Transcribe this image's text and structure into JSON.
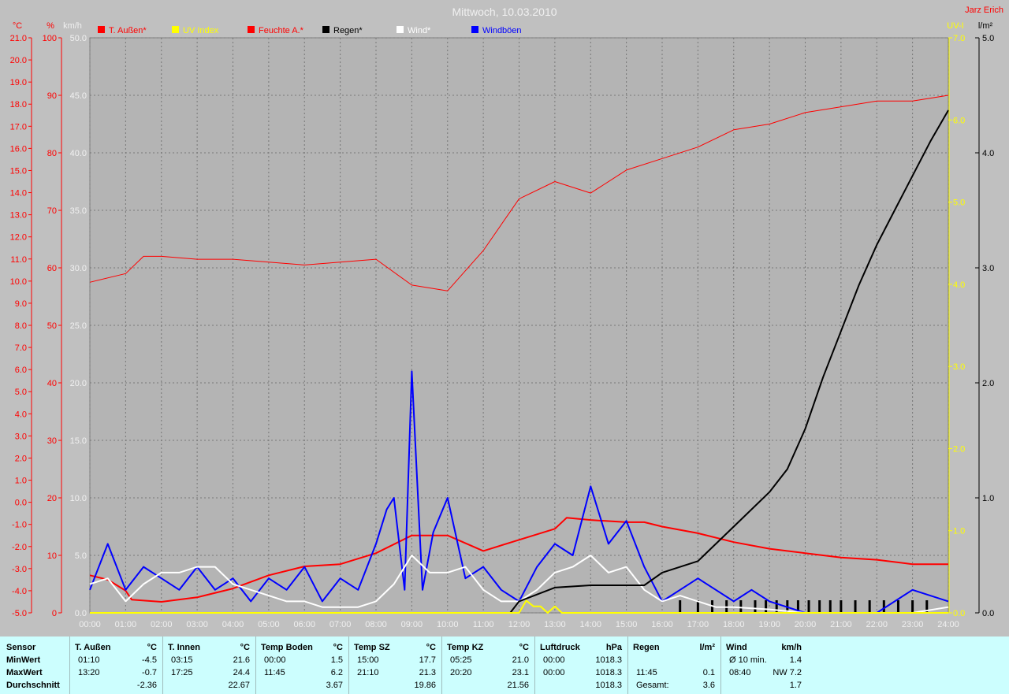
{
  "title": "Mittwoch, 10.03.2010",
  "author": "Jarz Erich",
  "axes": {
    "temp_unit": "°C",
    "temp_ticks": [
      "21.0",
      "20.0",
      "19.0",
      "18.0",
      "17.0",
      "16.0",
      "15.0",
      "14.0",
      "13.0",
      "12.0",
      "11.0",
      "10.0",
      "9.0",
      "8.0",
      "7.0",
      "6.0",
      "5.0",
      "4.0",
      "3.0",
      "2.0",
      "1.0",
      "0.0",
      "-1.0",
      "-2.0",
      "-3.0",
      "-4.0",
      "-5.0"
    ],
    "hum_unit": "%",
    "hum_ticks": [
      "100",
      "90",
      "80",
      "70",
      "60",
      "50",
      "40",
      "30",
      "20",
      "10",
      "0"
    ],
    "wind_unit": "km/h",
    "wind_ticks": [
      "50.0",
      "45.0",
      "40.0",
      "35.0",
      "30.0",
      "25.0",
      "20.0",
      "15.0",
      "10.0",
      "5.0",
      "0.0"
    ],
    "uv_unit": "UV-I",
    "uv_ticks": [
      "7.0",
      "6.0",
      "5.0",
      "4.0",
      "3.0",
      "2.0",
      "1.0",
      "0.0"
    ],
    "rain_unit": "l/m²",
    "rain_ticks": [
      "5.0",
      "4.0",
      "3.0",
      "2.0",
      "1.0",
      "0.0"
    ],
    "x_ticks": [
      "00:00",
      "01:00",
      "02:00",
      "03:00",
      "04:00",
      "05:00",
      "06:00",
      "07:00",
      "08:00",
      "09:00",
      "10:00",
      "11:00",
      "12:00",
      "13:00",
      "14:00",
      "15:00",
      "16:00",
      "17:00",
      "18:00",
      "19:00",
      "20:00",
      "21:00",
      "22:00",
      "23:00",
      "24:00"
    ]
  },
  "legend": [
    {
      "label": "T. Außen*",
      "color": "#ff0000"
    },
    {
      "label": "UV Index",
      "color": "#ffff00"
    },
    {
      "label": "Feuchte A.*",
      "color": "#ff0000"
    },
    {
      "label": "Regen*",
      "color": "#000000"
    },
    {
      "label": "Wind*",
      "color": "#ffffff"
    },
    {
      "label": "Windböen",
      "color": "#0000ff"
    }
  ],
  "chart_data": {
    "type": "line",
    "title": "Mittwoch, 10.03.2010",
    "x_unit": "hour",
    "series": [
      {
        "name": "T. Außen*",
        "axis": "temp",
        "color": "#ff0000",
        "points": [
          [
            0,
            -3.3
          ],
          [
            0.5,
            -3.5
          ],
          [
            1,
            -4.0
          ],
          [
            1.17,
            -4.4
          ],
          [
            2,
            -4.5
          ],
          [
            3,
            -4.3
          ],
          [
            4,
            -3.9
          ],
          [
            5,
            -3.3
          ],
          [
            6,
            -2.9
          ],
          [
            7,
            -2.8
          ],
          [
            8,
            -2.3
          ],
          [
            9,
            -1.5
          ],
          [
            10,
            -1.5
          ],
          [
            11,
            -2.2
          ],
          [
            12,
            -1.7
          ],
          [
            13,
            -1.2
          ],
          [
            13.33,
            -0.7
          ],
          [
            14,
            -0.8
          ],
          [
            15,
            -0.9
          ],
          [
            15.5,
            -0.9
          ],
          [
            16,
            -1.1
          ],
          [
            17,
            -1.4
          ],
          [
            18,
            -1.8
          ],
          [
            19,
            -2.1
          ],
          [
            20,
            -2.3
          ],
          [
            21,
            -2.5
          ],
          [
            22,
            -2.6
          ],
          [
            23,
            -2.8
          ],
          [
            24,
            -2.8
          ]
        ]
      },
      {
        "name": "Feuchte A.*",
        "axis": "hum",
        "color": "#ff0000",
        "points": [
          [
            0,
            57.5
          ],
          [
            1,
            59
          ],
          [
            1.5,
            62
          ],
          [
            2,
            62
          ],
          [
            3,
            61.5
          ],
          [
            4,
            61.5
          ],
          [
            5,
            61
          ],
          [
            6,
            60.5
          ],
          [
            7,
            61
          ],
          [
            8,
            61.5
          ],
          [
            9,
            57
          ],
          [
            10,
            56
          ],
          [
            11,
            63
          ],
          [
            12,
            72
          ],
          [
            13,
            75
          ],
          [
            14,
            73
          ],
          [
            15,
            77
          ],
          [
            16,
            79
          ],
          [
            17,
            81
          ],
          [
            18,
            84
          ],
          [
            19,
            85
          ],
          [
            20,
            87
          ],
          [
            21,
            88
          ],
          [
            22,
            89
          ],
          [
            23,
            89
          ],
          [
            24,
            90
          ]
        ]
      },
      {
        "name": "Windböen",
        "axis": "wind",
        "color": "#0000ff",
        "points": [
          [
            0,
            2
          ],
          [
            0.5,
            6
          ],
          [
            1,
            2
          ],
          [
            1.5,
            4
          ],
          [
            2,
            3
          ],
          [
            2.5,
            2
          ],
          [
            3,
            4
          ],
          [
            3.5,
            2
          ],
          [
            4,
            3
          ],
          [
            4.5,
            1
          ],
          [
            5,
            3
          ],
          [
            5.5,
            2
          ],
          [
            6,
            4
          ],
          [
            6.5,
            1
          ],
          [
            7,
            3
          ],
          [
            7.5,
            2
          ],
          [
            8,
            6
          ],
          [
            8.3,
            9
          ],
          [
            8.5,
            10
          ],
          [
            8.8,
            2
          ],
          [
            9,
            21
          ],
          [
            9.3,
            2
          ],
          [
            9.6,
            7
          ],
          [
            10,
            10
          ],
          [
            10.5,
            3
          ],
          [
            11,
            4
          ],
          [
            11.5,
            2
          ],
          [
            12,
            1
          ],
          [
            12.5,
            4
          ],
          [
            13,
            6
          ],
          [
            13.5,
            5
          ],
          [
            14,
            11
          ],
          [
            14.5,
            6
          ],
          [
            15,
            8
          ],
          [
            15.5,
            4
          ],
          [
            16,
            1
          ],
          [
            16.5,
            2
          ],
          [
            17,
            3
          ],
          [
            17.5,
            2
          ],
          [
            18,
            1
          ],
          [
            18.5,
            2
          ],
          [
            19,
            1
          ],
          [
            20,
            0
          ],
          [
            21,
            0
          ],
          [
            22,
            0
          ],
          [
            23,
            2
          ],
          [
            24,
            1
          ]
        ]
      },
      {
        "name": "Wind*",
        "axis": "wind",
        "color": "#ffffff",
        "points": [
          [
            0,
            2.5
          ],
          [
            0.5,
            3
          ],
          [
            1,
            1
          ],
          [
            1.5,
            2.5
          ],
          [
            2,
            3.5
          ],
          [
            2.5,
            3.5
          ],
          [
            3,
            4
          ],
          [
            3.5,
            4
          ],
          [
            4,
            2.5
          ],
          [
            4.5,
            2
          ],
          [
            5,
            1.5
          ],
          [
            5.5,
            1
          ],
          [
            6,
            1
          ],
          [
            6.5,
            0.5
          ],
          [
            7,
            0.5
          ],
          [
            7.5,
            0.5
          ],
          [
            8,
            1
          ],
          [
            8.5,
            2.5
          ],
          [
            9,
            5
          ],
          [
            9.5,
            3.5
          ],
          [
            10,
            3.5
          ],
          [
            10.5,
            4
          ],
          [
            11,
            2
          ],
          [
            11.5,
            1
          ],
          [
            12,
            1
          ],
          [
            12.5,
            2
          ],
          [
            13,
            3.5
          ],
          [
            13.5,
            4
          ],
          [
            14,
            5
          ],
          [
            14.5,
            3.5
          ],
          [
            15,
            4
          ],
          [
            15.5,
            2
          ],
          [
            16,
            1
          ],
          [
            16.5,
            1.5
          ],
          [
            17,
            1
          ],
          [
            17.5,
            0.5
          ],
          [
            18,
            0.5
          ],
          [
            19,
            0.3
          ],
          [
            20,
            0
          ],
          [
            21,
            0
          ],
          [
            22,
            0
          ],
          [
            23,
            0
          ],
          [
            24,
            0.5
          ]
        ]
      },
      {
        "name": "Regen*",
        "axis": "rain",
        "color": "#000000",
        "points": [
          [
            11.75,
            0
          ],
          [
            12,
            0.1
          ],
          [
            13,
            0.22
          ],
          [
            14,
            0.24
          ],
          [
            15,
            0.24
          ],
          [
            15.5,
            0.24
          ],
          [
            16,
            0.35
          ],
          [
            17,
            0.45
          ],
          [
            18,
            0.75
          ],
          [
            19,
            1.05
          ],
          [
            19.5,
            1.25
          ],
          [
            20,
            1.6
          ],
          [
            20.5,
            2.05
          ],
          [
            21,
            2.45
          ],
          [
            21.5,
            2.85
          ],
          [
            22,
            3.2
          ],
          [
            22.5,
            3.5
          ],
          [
            23,
            3.8
          ],
          [
            23.5,
            4.1
          ],
          [
            24,
            4.37
          ]
        ]
      },
      {
        "name": "UV Index",
        "axis": "uv",
        "color": "#ffff00",
        "points": [
          [
            0,
            0
          ],
          [
            12,
            0
          ],
          [
            12.2,
            0.15
          ],
          [
            12.4,
            0.08
          ],
          [
            12.6,
            0.08
          ],
          [
            12.8,
            0
          ],
          [
            13,
            0.08
          ],
          [
            13.2,
            0
          ],
          [
            24,
            0
          ]
        ]
      }
    ],
    "rain_bars_hours": [
      16.5,
      17,
      17.4,
      17.8,
      18.2,
      18.6,
      18.9,
      19.2,
      19.5,
      19.8,
      20.1,
      20.4,
      20.7,
      21.0,
      21.4,
      21.8,
      22.2,
      22.6,
      23.0,
      23.4
    ],
    "axes_ranges": {
      "temp": [
        -5,
        21
      ],
      "hum": [
        0,
        100
      ],
      "wind": [
        0,
        50
      ],
      "uv": [
        0,
        7
      ],
      "rain": [
        0,
        5
      ],
      "x": [
        0,
        24
      ]
    },
    "grid": true
  },
  "stats": {
    "columns": [
      {
        "h1": "Sensor",
        "rows": [
          "MinWert",
          "MaxWert",
          "Durchschnitt"
        ]
      },
      {
        "h1": "T. Außen",
        "h2": "°C",
        "a": [
          "01:10",
          "13:20",
          ""
        ],
        "b": [
          "-4.5",
          "-0.7",
          "-2.36"
        ]
      },
      {
        "h1": "T. Innen",
        "h2": "°C",
        "a": [
          "03:15",
          "17:25",
          ""
        ],
        "b": [
          "21.6",
          "24.4",
          "22.67"
        ]
      },
      {
        "h1": "Temp Boden",
        "h2": "°C",
        "a": [
          "00:00",
          "11:45",
          ""
        ],
        "b": [
          "1.5",
          "6.2",
          "3.67"
        ]
      },
      {
        "h1": "Temp SZ",
        "h2": "°C",
        "a": [
          "15:00",
          "21:10",
          ""
        ],
        "b": [
          "17.7",
          "21.3",
          "19.86"
        ]
      },
      {
        "h1": "Temp KZ",
        "h2": "°C",
        "a": [
          "05:25",
          "20:20",
          ""
        ],
        "b": [
          "21.0",
          "23.1",
          "21.56"
        ]
      },
      {
        "h1": "Luftdruck",
        "h2": "hPa",
        "a": [
          "00:00",
          "00:00",
          ""
        ],
        "b": [
          "1018.3",
          "1018.3",
          "1018.3"
        ]
      },
      {
        "h1": "Regen",
        "h2": "l/m²",
        "a": [
          "",
          "11:45",
          "Gesamt:"
        ],
        "b": [
          "",
          "0.1",
          "3.6"
        ]
      },
      {
        "h1": "Wind",
        "h2": "km/h",
        "a": [
          "Ø 10 min.",
          "08:40",
          ""
        ],
        "b": [
          "1.4",
          "NW 7.2",
          "1.7"
        ]
      }
    ]
  }
}
